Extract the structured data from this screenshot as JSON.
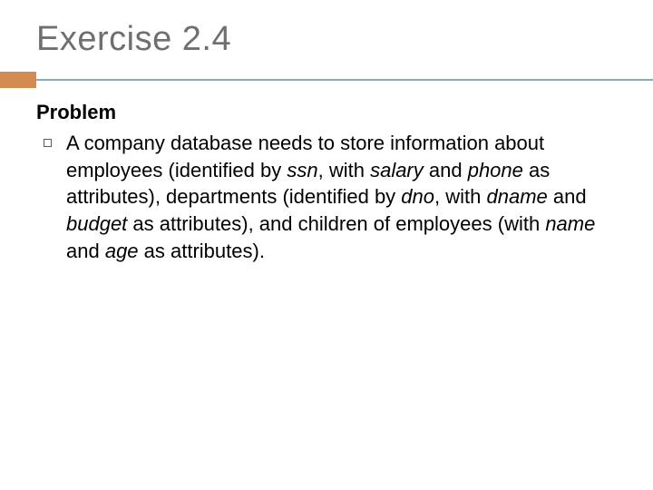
{
  "title": "Exercise 2.4",
  "problem_label": "Problem",
  "body": {
    "p1": "A company database needs to store information about employees (identified by ",
    "ssn": "ssn",
    "p2": ", with ",
    "salary": "salary",
    "p3": " and ",
    "phone": "phone",
    "p4": " as attributes), departments (identified by ",
    "dno": "dno",
    "p5": ", with ",
    "dname": "dname",
    "p6": " and ",
    "budget": "budget",
    "p7": " as attributes), and children of employees (with ",
    "name_attr": "name",
    "p8": " and ",
    "age_attr": "age",
    "p9": " as attributes)."
  }
}
